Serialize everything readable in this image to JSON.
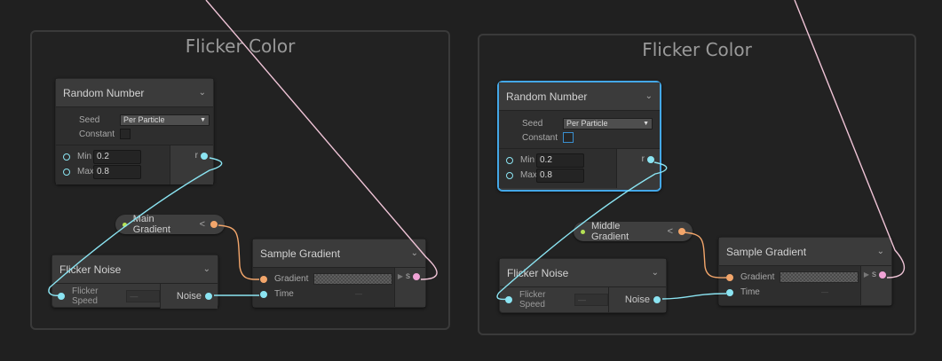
{
  "colors": {
    "background": "#202020",
    "node_bg": "#393939",
    "selection": "#44a8e8",
    "float_port": "#8be4f2",
    "gradient_port": "#f3a66b",
    "color_wire": "#f0a3d6",
    "bool_dot": "#b5e255"
  },
  "graphs": [
    {
      "group_title": "Flicker Color",
      "random_number": {
        "title": "Random Number",
        "seed_label": "Seed",
        "seed_value": "Per Particle",
        "constant_label": "Constant",
        "min_label": "Min",
        "min_value": "0.2",
        "max_label": "Max",
        "max_value": "0.8",
        "output_label": "r"
      },
      "gradient_prop": {
        "label": "Main Gradient",
        "arrow": "<"
      },
      "flicker_noise": {
        "title": "Flicker Noise",
        "input_label": "Flicker Speed",
        "output_label": "Noise"
      },
      "sample_gradient": {
        "title": "Sample Gradient",
        "gradient_label": "Gradient",
        "time_label": "Time",
        "output_label": "s"
      }
    },
    {
      "group_title": "Flicker Color",
      "random_number": {
        "title": "Random Number",
        "seed_label": "Seed",
        "seed_value": "Per Particle",
        "constant_label": "Constant",
        "min_label": "Min",
        "min_value": "0.2",
        "max_label": "Max",
        "max_value": "0.8",
        "output_label": "r"
      },
      "gradient_prop": {
        "label": "Middle Gradient",
        "arrow": "<"
      },
      "flicker_noise": {
        "title": "Flicker Noise",
        "input_label": "Flicker Speed",
        "output_label": "Noise"
      },
      "sample_gradient": {
        "title": "Sample Gradient",
        "gradient_label": "Gradient",
        "time_label": "Time",
        "output_label": "s"
      }
    }
  ]
}
